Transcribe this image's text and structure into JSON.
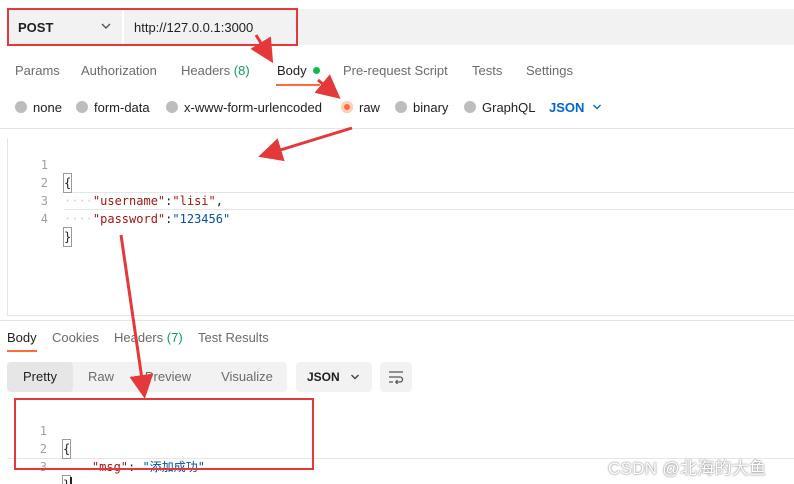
{
  "request": {
    "method": "POST",
    "url": "http://127.0.0.1:3000"
  },
  "tabs": [
    {
      "label": "Params"
    },
    {
      "label": "Authorization"
    },
    {
      "label": "Headers",
      "count": "(8)"
    },
    {
      "label": "Body",
      "active": true
    },
    {
      "label": "Pre-request Script"
    },
    {
      "label": "Tests"
    },
    {
      "label": "Settings"
    }
  ],
  "body_types": [
    {
      "label": "none"
    },
    {
      "label": "form-data"
    },
    {
      "label": "x-www-form-urlencoded"
    },
    {
      "label": "raw",
      "selected": true
    },
    {
      "label": "binary"
    },
    {
      "label": "GraphQL"
    }
  ],
  "body_format": "JSON",
  "editor": {
    "line_numbers": [
      "1",
      "2",
      "3",
      "4"
    ],
    "open_brace": "{",
    "key1": "\"username\"",
    "val1": "\"lisi\"",
    "key2": "\"password\"",
    "val2": "\"123456\"",
    "close_brace": "}"
  },
  "response": {
    "tabs": [
      {
        "label": "Body",
        "active": true
      },
      {
        "label": "Cookies"
      },
      {
        "label": "Headers",
        "count": "(7)"
      },
      {
        "label": "Test Results"
      }
    ],
    "views": [
      {
        "label": "Pretty",
        "active": true
      },
      {
        "label": "Raw"
      },
      {
        "label": "Preview"
      },
      {
        "label": "Visualize"
      }
    ],
    "format": "JSON",
    "line_numbers": [
      "1",
      "2",
      "3"
    ],
    "open_brace": "{",
    "key": "\"msg\"",
    "value": "\"添加成功\"",
    "close_brace": "}"
  },
  "watermark": "CSDN @北海的大鱼",
  "colors": {
    "accent": "#ff6c37",
    "success": "#0cbb52",
    "link_blue": "#0265d2",
    "annotation_red": "#e5383b"
  }
}
